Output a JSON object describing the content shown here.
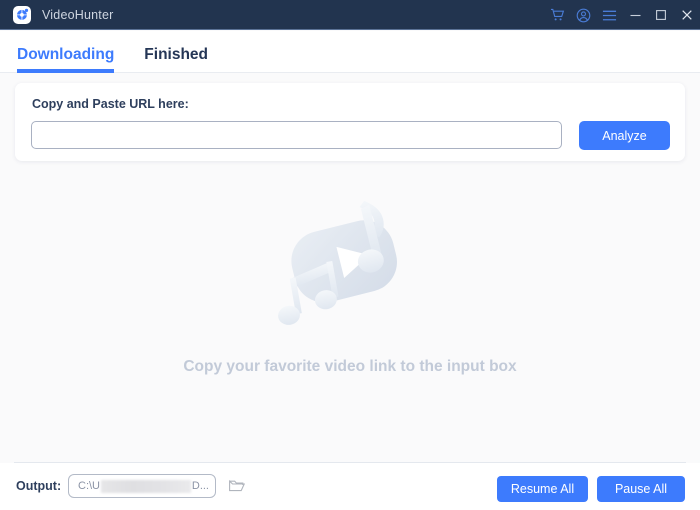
{
  "window": {
    "app_title": "VideoHunter",
    "app_icon": "videohunter-logo-icon",
    "titlebar_color": "#22344f",
    "accent_color": "#3d7bfd",
    "controls": [
      {
        "name": "cart-icon",
        "label": "Cart"
      },
      {
        "name": "account-icon",
        "label": "Account"
      },
      {
        "name": "menu-icon",
        "label": "Menu"
      },
      {
        "name": "minimize-icon",
        "label": "Minimize"
      },
      {
        "name": "maximize-icon",
        "label": "Maximize"
      },
      {
        "name": "close-icon",
        "label": "Close"
      }
    ]
  },
  "tabs": [
    {
      "label": "Downloading",
      "active": true
    },
    {
      "label": "Finished",
      "active": false
    }
  ],
  "url_card": {
    "label": "Copy and Paste URL here:",
    "input_value": "",
    "input_placeholder": "",
    "analyze_label": "Analyze"
  },
  "empty_state": {
    "message": "Copy your favorite video link to the input box",
    "illustration": "video-music-placeholder-icon",
    "illustration_color": "#dfe5ed",
    "text_color": "#c2cad8"
  },
  "bottom_bar": {
    "output_label": "Output:",
    "output_path_prefix": "C:\\U",
    "output_path_suffix": "D...",
    "output_path_redacted": true,
    "folder_icon": "open-folder-icon",
    "resume_all_label": "Resume All",
    "pause_all_label": "Pause All"
  }
}
